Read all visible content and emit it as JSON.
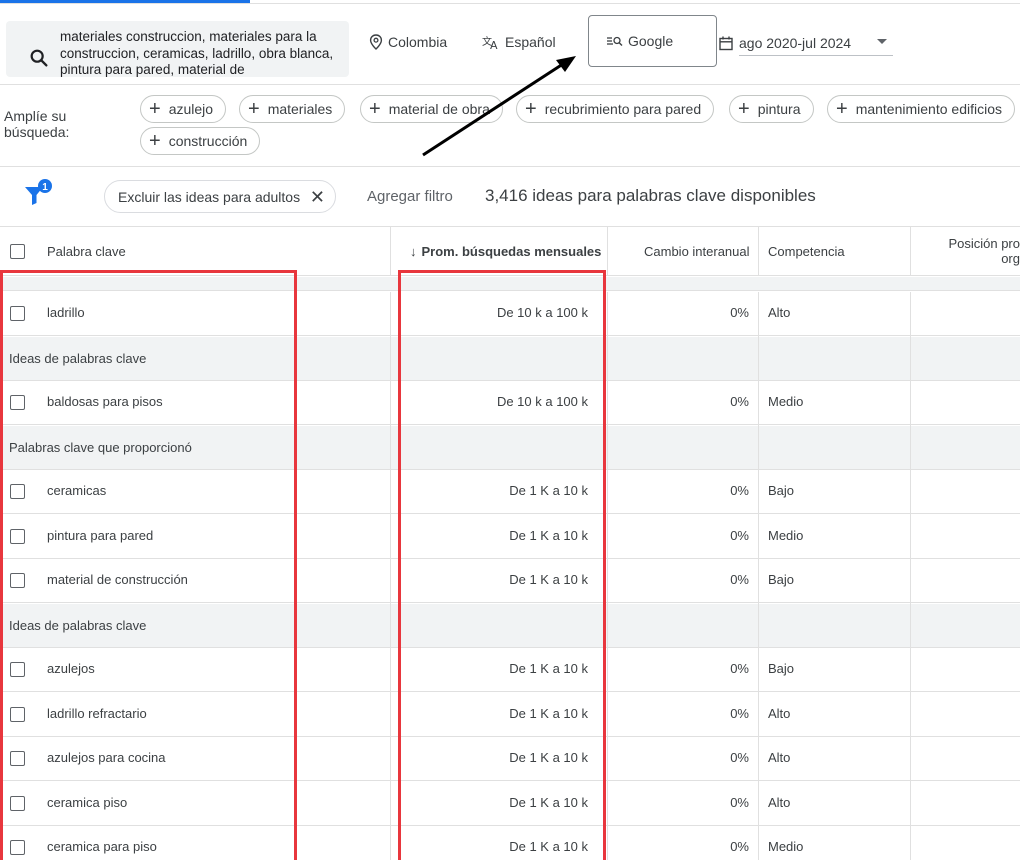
{
  "search": {
    "query": "materiales construccion, materiales para la construccion, ceramicas, ladrillo, obra blanca, pintura para pared, material de",
    "location": "Colombia",
    "language": "Español",
    "network": "Google",
    "date_range": "ago 2020-jul 2024"
  },
  "broaden": {
    "label": "Amplíe su búsqueda:",
    "chips": [
      "azulejo",
      "materiales",
      "material de obra",
      "recubrimiento para pared",
      "pintura",
      "mantenimiento edificios",
      "construcción"
    ]
  },
  "filters": {
    "badge_count": "1",
    "adult_filter": "Excluir las ideas para adultos",
    "add_filter": "Agregar filtro",
    "ideas_available": "3,416 ideas para palabras clave disponibles"
  },
  "table": {
    "columns": {
      "keyword": "Palabra clave",
      "avg_searches": "Prom. búsquedas mensuales",
      "yoy_change": "Cambio interanual",
      "competition": "Competencia",
      "organic_position_line1": "Posición pro",
      "organic_position_line2": "org"
    },
    "sort_arrow": "↓",
    "rows": [
      {
        "type": "keyword",
        "keyword": "ladrillo",
        "volume": "De 10 k a 100 k",
        "change": "0%",
        "competition": "Alto"
      },
      {
        "type": "group",
        "label": "Ideas de palabras clave"
      },
      {
        "type": "keyword",
        "keyword": "baldosas para pisos",
        "volume": "De 10 k a 100 k",
        "change": "0%",
        "competition": "Medio"
      },
      {
        "type": "group",
        "label": "Palabras clave que proporcionó"
      },
      {
        "type": "keyword",
        "keyword": "ceramicas",
        "volume": "De 1 K a 10 k",
        "change": "0%",
        "competition": "Bajo"
      },
      {
        "type": "keyword",
        "keyword": "pintura para pared",
        "volume": "De 1 K a 10 k",
        "change": "0%",
        "competition": "Medio"
      },
      {
        "type": "keyword",
        "keyword": "material de construcción",
        "volume": "De 1 K a 10 k",
        "change": "0%",
        "competition": "Bajo"
      },
      {
        "type": "group",
        "label": "Ideas de palabras clave"
      },
      {
        "type": "keyword",
        "keyword": "azulejos",
        "volume": "De 1 K a 10 k",
        "change": "0%",
        "competition": "Bajo"
      },
      {
        "type": "keyword",
        "keyword": "ladrillo refractario",
        "volume": "De 1 K a 10 k",
        "change": "0%",
        "competition": "Alto"
      },
      {
        "type": "keyword",
        "keyword": "azulejos para cocina",
        "volume": "De 1 K a 10 k",
        "change": "0%",
        "competition": "Alto"
      },
      {
        "type": "keyword",
        "keyword": "ceramica piso",
        "volume": "De 1 K a 10 k",
        "change": "0%",
        "competition": "Alto"
      },
      {
        "type": "keyword",
        "keyword": "ceramica para piso",
        "volume": "De 1 K a 10 k",
        "change": "0%",
        "competition": "Medio"
      }
    ]
  },
  "colors": {
    "accent": "#1a73e8",
    "highlight": "#e8363d",
    "group_background": "#f1f3f4"
  }
}
